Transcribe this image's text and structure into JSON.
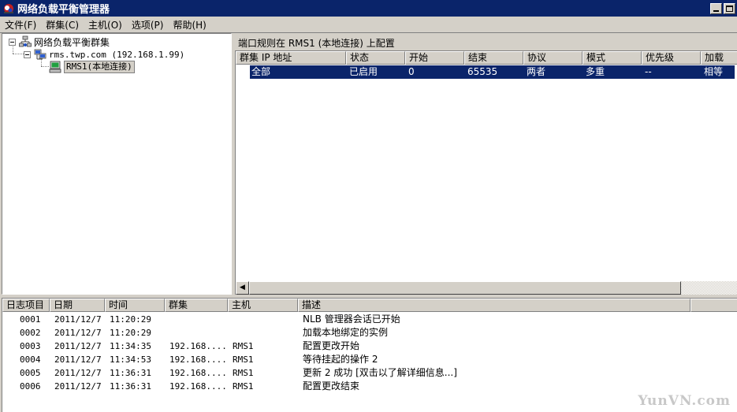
{
  "window": {
    "title": "网络负载平衡管理器",
    "minimize_icon": "minimize-icon",
    "maximize_icon": "maximize-icon"
  },
  "menu": {
    "items": [
      "文件(F)",
      "群集(C)",
      "主机(O)",
      "选项(P)",
      "帮助(H)"
    ]
  },
  "tree": {
    "root_label": "网络负载平衡群集",
    "cluster_label": "rms.twp.com (192.168.1.99)",
    "host_label": "RMS1(本地连接)",
    "root_icon": "network-cluster-icon",
    "cluster_icon": "cluster-icon",
    "host_icon": "host-computer-icon"
  },
  "port_rules": {
    "header": "端口规则在 RMS1 (本地连接) 上配置",
    "columns": [
      "群集 IP 地址",
      "状态",
      "开始",
      "结束",
      "协议",
      "模式",
      "优先级",
      "加载"
    ],
    "rows": [
      [
        "全部",
        "已启用",
        "0",
        "65535",
        "两者",
        "多重",
        "--",
        "相等"
      ]
    ],
    "scroll_left_icon": "scroll-left-icon"
  },
  "log": {
    "columns": [
      "日志项目",
      "日期",
      "时间",
      "群集",
      "主机",
      "描述"
    ],
    "rows": [
      [
        "0001",
        "2011/12/7",
        "11:20:29",
        "",
        "",
        "NLB 管理器会话已开始"
      ],
      [
        "0002",
        "2011/12/7",
        "11:20:29",
        "",
        "",
        "加载本地绑定的实例"
      ],
      [
        "0003",
        "2011/12/7",
        "11:34:35",
        "192.168....",
        "RMS1",
        "配置更改开始"
      ],
      [
        "0004",
        "2011/12/7",
        "11:34:53",
        "192.168....",
        "RMS1",
        "等待挂起的操作 2"
      ],
      [
        "0005",
        "2011/12/7",
        "11:36:31",
        "192.168....",
        "RMS1",
        "更新 2 成功 [双击以了解详细信息...]"
      ],
      [
        "0006",
        "2011/12/7",
        "11:36:31",
        "192.168....",
        "RMS1",
        "配置更改结束"
      ]
    ]
  },
  "watermark": "YunVN.com",
  "colors": {
    "title_bar": "#0a246a",
    "selection": "#0a246a",
    "chrome": "#d4d0c8"
  }
}
